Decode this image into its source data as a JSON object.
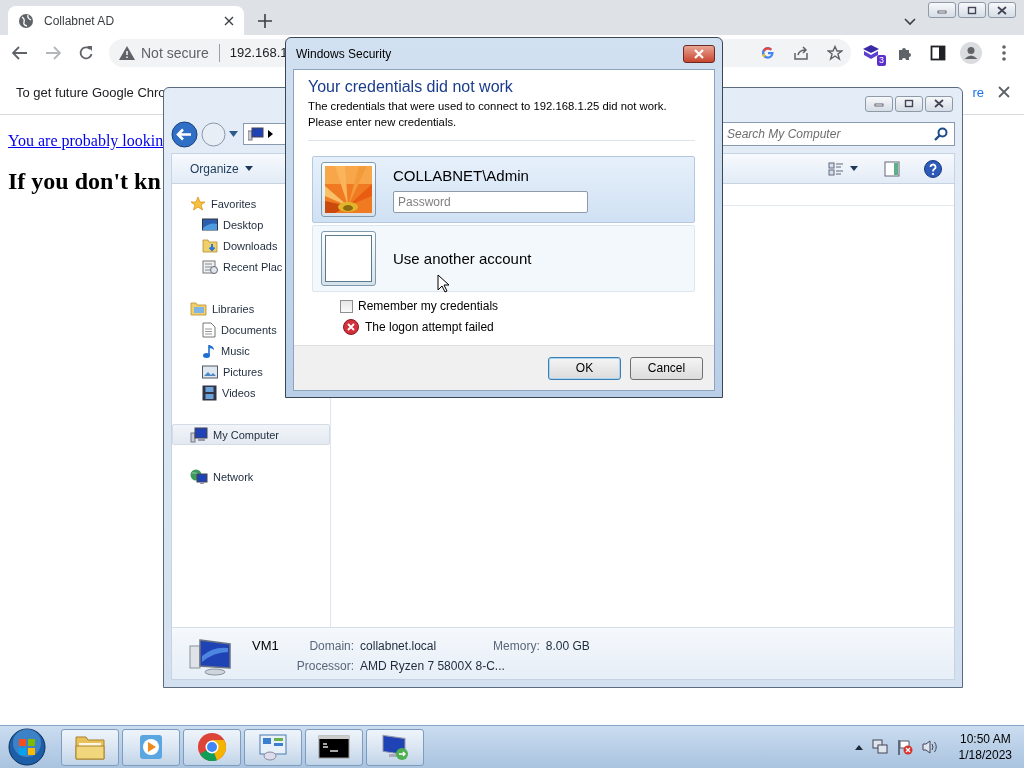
{
  "browser": {
    "tabs": [
      {
        "title": "Collabnet AD",
        "selected": true
      }
    ],
    "address": {
      "security": "Not secure",
      "url": "192.168.1"
    },
    "extension_badge": "3",
    "infobar": {
      "text": "To get future Google Chro",
      "link": "re"
    },
    "page": {
      "link": "You are probably lookin",
      "heading": "If you don't kn"
    }
  },
  "explorer": {
    "toolbar": [
      {
        "label": "Organize",
        "menu": true
      }
    ],
    "search": {
      "placeholder": "Search My Computer"
    },
    "nav": [
      {
        "label": "Favorites",
        "selected": false,
        "children": [
          {
            "label": "Desktop",
            "selected": false
          },
          {
            "label": "Downloads",
            "selected": false
          },
          {
            "label": "Recent Plac",
            "selected": false
          }
        ]
      },
      {
        "label": "Libraries",
        "selected": false,
        "children": [
          {
            "label": "Documents",
            "selected": false
          },
          {
            "label": "Music",
            "selected": false
          },
          {
            "label": "Pictures",
            "selected": false
          },
          {
            "label": "Videos",
            "selected": false
          }
        ]
      },
      {
        "label": "My Computer",
        "selected": true
      },
      {
        "label": "Network",
        "selected": false
      }
    ],
    "details": {
      "name": "VM1",
      "fields": [
        {
          "label": "Domain:",
          "value": "collabnet.local"
        },
        {
          "label": "Memory:",
          "value": "8.00 GB"
        },
        {
          "label": "Processor:",
          "value": "AMD Ryzen 7 5800X 8-C..."
        }
      ]
    }
  },
  "dialog": {
    "title": "Windows Security",
    "heading": "Your credentials did not work",
    "message": "The credentials that were used to connect to 192.168.1.25 did not work. Please enter new credentials.",
    "accounts": [
      {
        "name": "COLLABNET\\Admin",
        "selected": true,
        "password": {
          "placeholder": "Password"
        }
      },
      {
        "name": "Use another account",
        "selected": false
      }
    ],
    "remember": {
      "label": "Remember my credentials",
      "checked": false
    },
    "error": "The logon attempt failed",
    "buttons": [
      {
        "label": "OK",
        "default": true
      },
      {
        "label": "Cancel",
        "default": false
      }
    ]
  },
  "taskbar": {
    "clock": {
      "time": "10:50 AM",
      "date": "1/18/2023"
    }
  }
}
